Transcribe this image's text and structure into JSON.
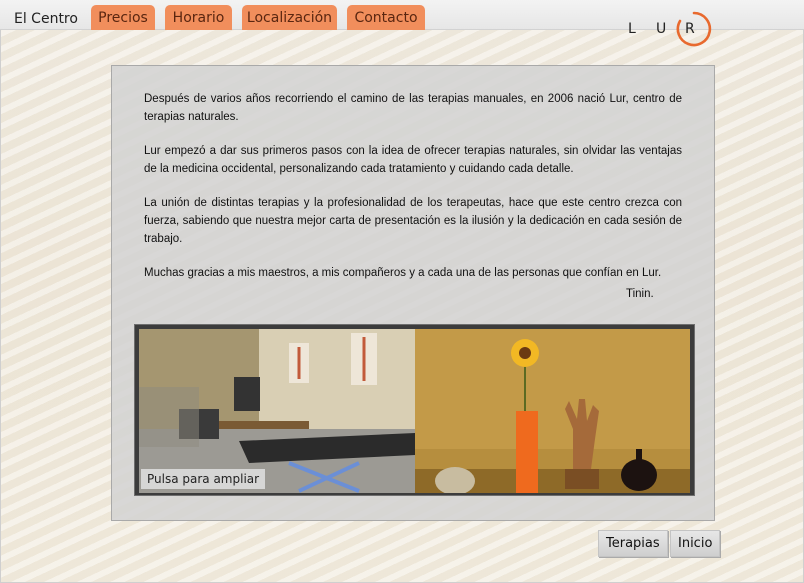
{
  "nav": {
    "current": "El Centro",
    "tabs": [
      "Precios",
      "Horario",
      "Localización",
      "Contacto"
    ]
  },
  "logo": {
    "letters": [
      "L",
      "U",
      "R"
    ],
    "accent": "#e8692e"
  },
  "colors": {
    "tab_bg": "#f18e5c",
    "tab_text": "#5a2610",
    "panel_bg": "#d2d2d2"
  },
  "content": {
    "paragraphs": [
      "Después de varios años recorriendo el camino de las terapias manuales, en 2006 nació Lur, centro de terapias naturales.",
      "Lur empezó a dar sus primeros pasos con la idea de ofrecer  terapias naturales, sin olvidar las ventajas de la medicina occidental, personalizando cada tratamiento y cuidando cada detalle.",
      "La unión de distintas terapias y la profesionalidad de los terapeutas, hace que este centro crezca con fuerza, sabiendo que nuestra mejor carta de  presentación es la ilusión y la dedicación en cada sesión de trabajo.",
      "Muchas gracias a mis maestros, a mis compañeros y a cada una de las personas que confían en Lur."
    ],
    "signature": "Tinin."
  },
  "gallery": {
    "caption": "Pulsa para ampliar"
  },
  "buttons": {
    "terapias": "Terapias",
    "inicio": "Inicio"
  }
}
